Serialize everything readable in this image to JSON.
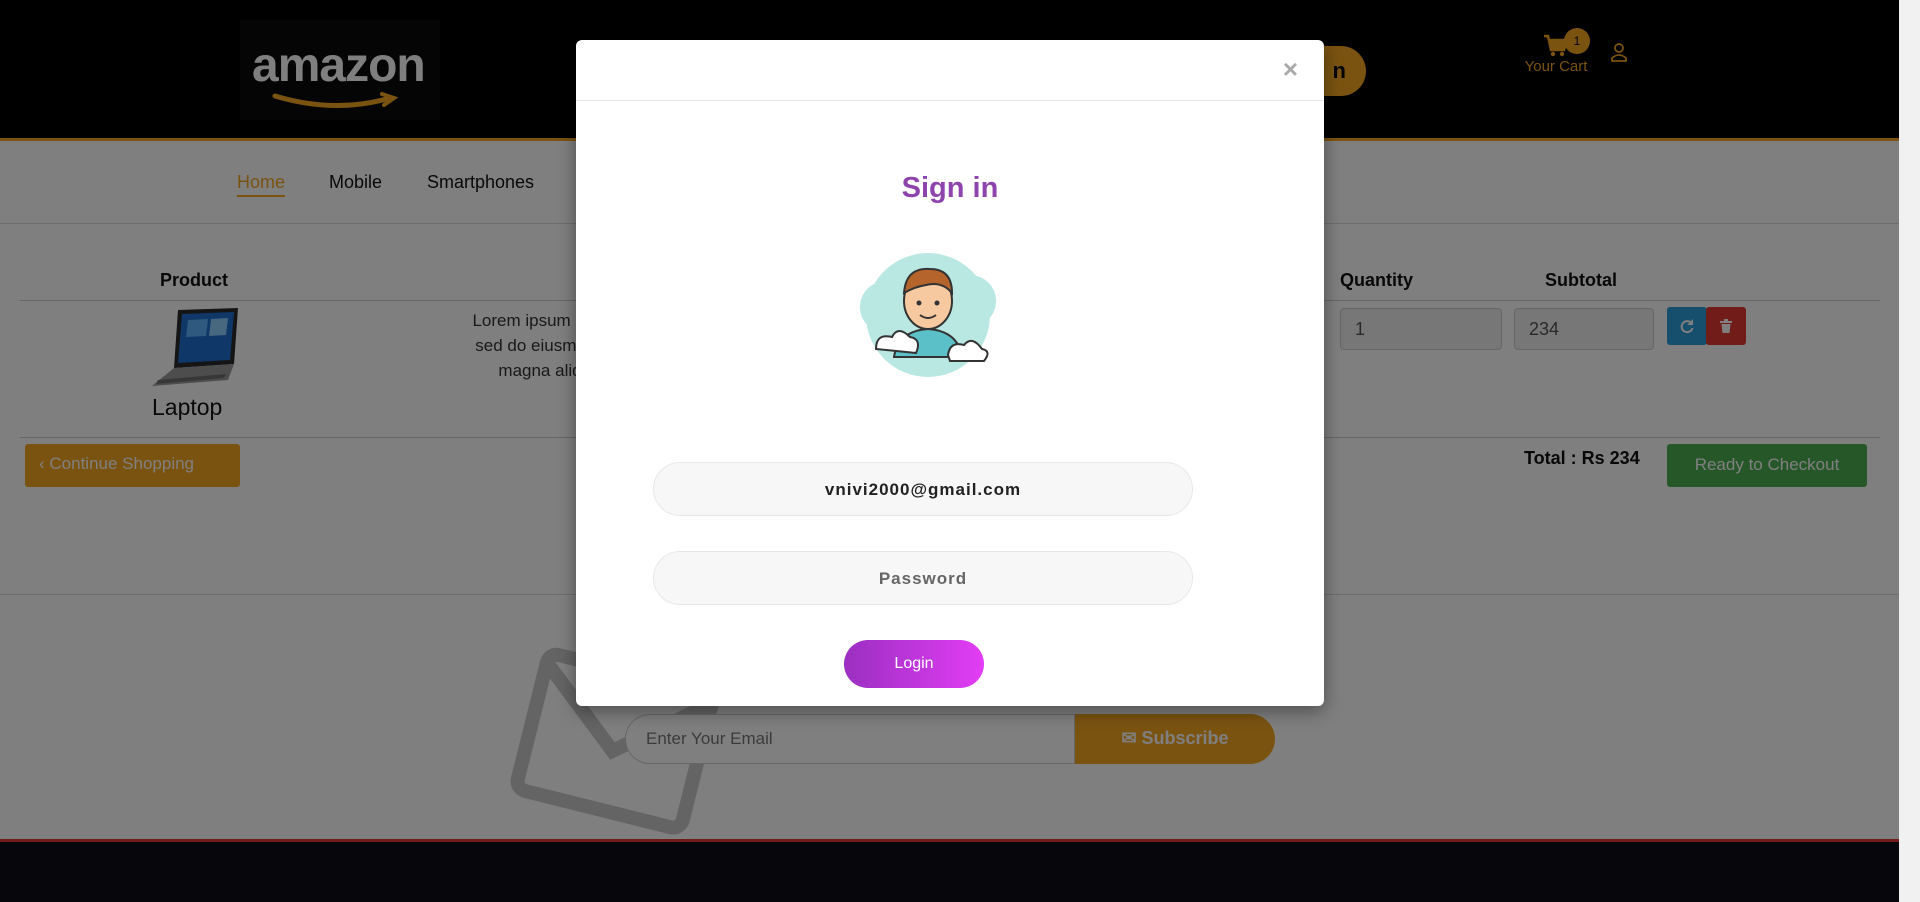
{
  "header": {
    "logo_text": "amazon",
    "search_button_label": "n",
    "cart_label": "Your Cart",
    "cart_count": "1"
  },
  "nav": {
    "items": [
      "Home",
      "Mobile",
      "Smartphones"
    ]
  },
  "cart_table": {
    "headers": {
      "product": "Product",
      "quantity": "Quantity",
      "subtotal": "Subtotal"
    },
    "row": {
      "product_name": "Laptop",
      "description_lines": [
        "Lorem ipsum dolo",
        "sed do eiusmod t",
        "magna aliq"
      ],
      "quantity": "1",
      "subtotal": "234"
    },
    "continue_label": "Continue Shopping",
    "total_label": "Total : Rs 234",
    "checkout_label": "Ready to Checkout"
  },
  "subscribe": {
    "email_placeholder": "Enter Your Email",
    "button_label": "Subscribe"
  },
  "modal": {
    "close_symbol": "×",
    "title": "Sign in",
    "email_value": "vnivi2000@gmail.com",
    "password_placeholder": "Password",
    "login_label": "Login"
  },
  "colors": {
    "accent": "#f5a623",
    "modal_title": "#8e44ad",
    "login_gradient_start": "#9b2fc1",
    "login_gradient_end": "#e23df5",
    "checkout_green": "#4caf50",
    "delete_red": "#e53935",
    "refresh_blue": "#2d9cdb"
  }
}
